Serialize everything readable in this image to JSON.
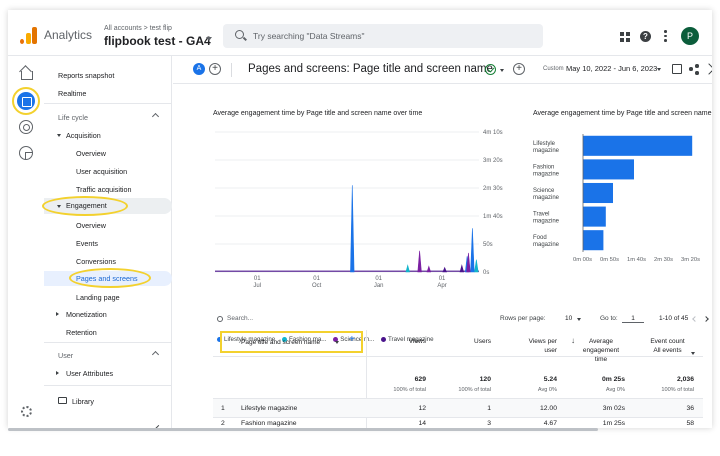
{
  "app": {
    "name": "Analytics",
    "breadcrumb": "All accounts > test flip",
    "property": "flipbook test - GA4"
  },
  "search": {
    "placeholder": "Try searching \"Data Streams\""
  },
  "user": {
    "avatar_initial": "P"
  },
  "colors": {
    "accent": "#1a73e8",
    "highlight": "#f3d12e",
    "purple": "#7b1fa2",
    "teal": "#12b5cb"
  },
  "sidebar": {
    "reports_snapshot": "Reports snapshot",
    "realtime": "Realtime",
    "life_cycle": "Life cycle",
    "acquisition": "Acquisition",
    "acq_items": [
      "Overview",
      "User acquisition",
      "Traffic acquisition"
    ],
    "engagement": "Engagement",
    "eng_items": [
      "Overview",
      "Events",
      "Conversions",
      "Pages and screens",
      "Landing page"
    ],
    "monetization": "Monetization",
    "retention": "Retention",
    "user": "User",
    "user_attributes": "User Attributes",
    "library": "Library"
  },
  "header": {
    "badge": "A",
    "title": "Pages and screens: Page title and screen name",
    "custom": "Custom",
    "date_range": "May 10, 2022 - Jun 6, 2023"
  },
  "line_card": {
    "title": "Average engagement time by Page title and screen name over time",
    "legend": [
      "Lifestyle magazine",
      "Fashion ma...",
      "Science m...",
      "Travel magazine"
    ]
  },
  "bar_card": {
    "title": "Average engagement time by Page title and screen name"
  },
  "chart_data": [
    {
      "type": "line",
      "title": "Average engagement time by Page title and screen name over time",
      "x_ticks": [
        "01\nJul",
        "01\nOct",
        "01\nJan",
        "01\nApr"
      ],
      "y_ticks": [
        "4m 10s",
        "3m 20s",
        "2m 30s",
        "1m 40s",
        "50s",
        "0s"
      ],
      "ylim": [
        0,
        250
      ],
      "series": [
        {
          "name": "Lifestyle magazine",
          "color": "#1a73e8",
          "spikes": [
            {
              "x": 0.52,
              "y": 155
            },
            {
              "x": 0.975,
              "y": 78
            },
            {
              "x": 0.955,
              "y": 28
            }
          ]
        },
        {
          "name": "Fashion ma...",
          "color": "#12b5cb",
          "spikes": [
            {
              "x": 0.73,
              "y": 12
            },
            {
              "x": 0.99,
              "y": 22
            }
          ]
        },
        {
          "name": "Science m...",
          "color": "#7b1fa2",
          "spikes": [
            {
              "x": 0.775,
              "y": 38
            },
            {
              "x": 0.81,
              "y": 10
            },
            {
              "x": 0.96,
              "y": 34
            }
          ]
        },
        {
          "name": "Travel magazine",
          "color": "#4a148c",
          "spikes": [
            {
              "x": 0.87,
              "y": 8
            },
            {
              "x": 0.935,
              "y": 12
            }
          ]
        }
      ]
    },
    {
      "type": "bar",
      "title": "Average engagement time by Page title and screen name",
      "categories": [
        "Lifestyle magazine",
        "Fashion magazine",
        "Science magazine",
        "Travel magazine",
        "Food magazine"
      ],
      "values": [
        182,
        85,
        50,
        38,
        34
      ],
      "x_ticks": [
        "0m 00s",
        "0m 50s",
        "1m 40s",
        "2m 30s",
        "3m 20s"
      ],
      "xlim": [
        0,
        200
      ]
    }
  ],
  "table": {
    "search_placeholder": "Search...",
    "rows_per_page_label": "Rows per page:",
    "rows_per_page": "10",
    "goto_label": "Go to:",
    "goto_value": "1",
    "page_info": "1-10 of 45",
    "dimension_header": "Page title and screen name",
    "columns": [
      "Views",
      "Users",
      "Views per\nuser",
      "Average\nengagement\ntime",
      "Event count\nAll events"
    ],
    "totals": [
      "629",
      "120",
      "5.24",
      "0m 25s",
      "2,036"
    ],
    "totals_sub": [
      "100% of total",
      "100% of total",
      "Avg 0%",
      "Avg 0%",
      "100% of total"
    ],
    "rows": [
      {
        "idx": "1",
        "name": "Lifestyle magazine",
        "vals": [
          "12",
          "1",
          "12.00",
          "3m 02s",
          "36"
        ]
      },
      {
        "idx": "2",
        "name": "Fashion magazine",
        "vals": [
          "14",
          "3",
          "4.67",
          "1m 25s",
          "58"
        ]
      }
    ]
  }
}
